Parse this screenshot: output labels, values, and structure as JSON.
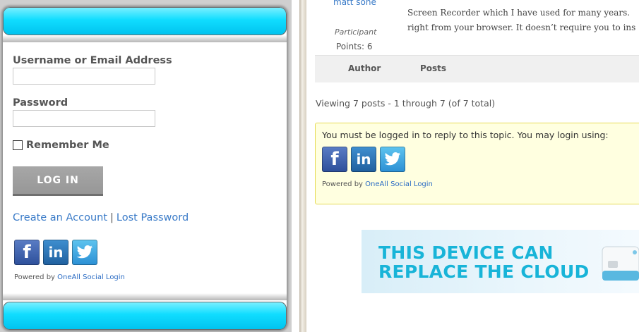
{
  "login": {
    "username_label": "Username or Email Address",
    "username_value": "",
    "password_label": "Password",
    "password_value": "",
    "remember_label": "Remember Me",
    "login_button": "LOG IN",
    "create_account": "Create an Account",
    "separator": "|",
    "lost_password": "Lost Password",
    "powered_prefix": "Powered by",
    "powered_link": "OneAll Social Login",
    "accent_color": "#10ddff"
  },
  "social_icons": [
    {
      "name": "facebook-icon",
      "glyph": "f"
    },
    {
      "name": "linkedin-icon",
      "glyph": "in"
    },
    {
      "name": "twitter-icon",
      "glyph": "t"
    }
  ],
  "reply": {
    "author_name": "matt sone",
    "role": "Participant",
    "points": "Points: 6",
    "text_line1": "Screen Recorder which I have used for many years.",
    "text_line2": "right from your browser. It doesn’t require you to ins",
    "header_author": "Author",
    "header_posts": "Posts",
    "viewing": "Viewing 7 posts - 1 through 7 (of 7 total)",
    "notice": "You must be logged in to reply to this topic. You may login using:",
    "powered_prefix": "Powered by",
    "powered_link": "OneAll Social Login"
  },
  "ad": {
    "line1": "THIS DEVICE CAN",
    "line2": "REPLACE THE CLOUD"
  }
}
